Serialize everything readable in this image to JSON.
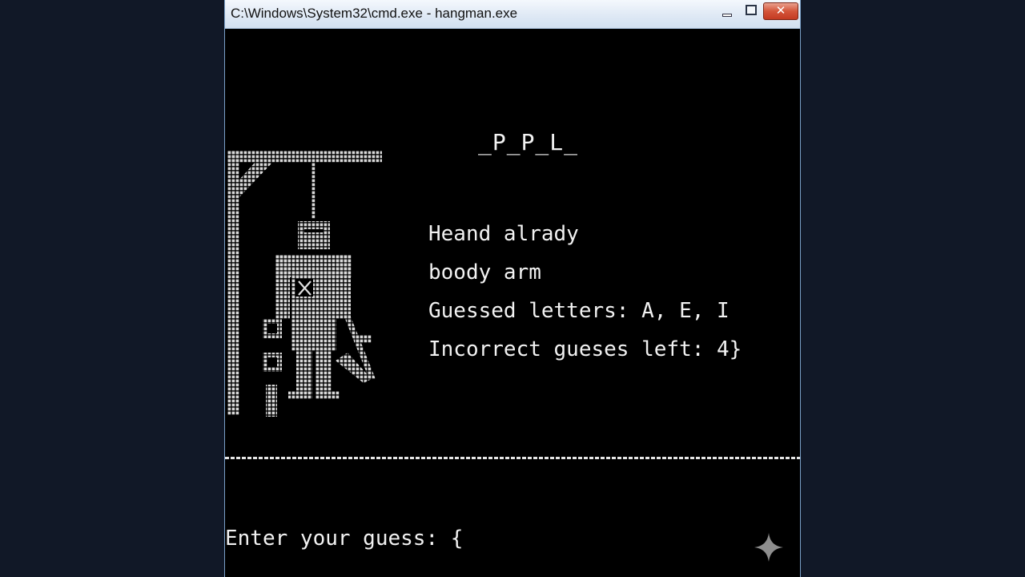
{
  "window": {
    "title": "C:\\Windows\\System32\\cmd.exe - hangman.exe",
    "minimize_icon": "minimize-icon",
    "maximize_icon": "maximize-icon",
    "close_glyph": "✕"
  },
  "game": {
    "word_display": "_P_P_L_",
    "status_line_1": "Heand alrady",
    "status_line_2": "boody arm",
    "guessed_letters": "Guessed letters: A, E, I",
    "incorrect_left": "Incorrect gueses left: 4}",
    "divider": "dashed-line",
    "prompt": "Enter your guess: {",
    "figure_icon": "hangman-figure-icon",
    "sparkle_icon": "sparkle-icon"
  },
  "colors": {
    "console_bg": "#000000",
    "console_text": "#f2f2f2",
    "desktop_bg": "#111827",
    "close_button": "#d4553a"
  }
}
